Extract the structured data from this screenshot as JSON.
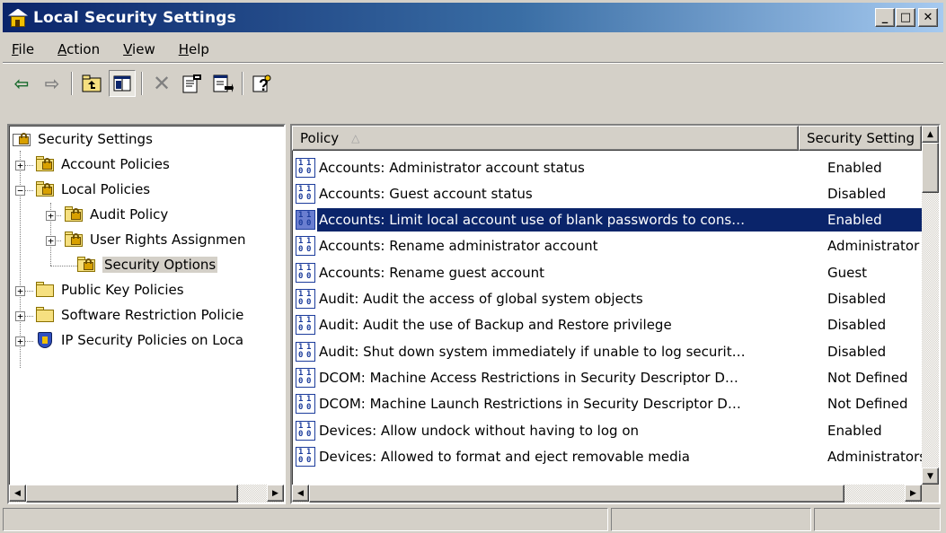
{
  "window": {
    "title": "Local Security Settings",
    "minimize_glyph": "_",
    "maximize_glyph": "□",
    "close_glyph": "✕"
  },
  "menu": [
    {
      "label": "File",
      "access_key": "F",
      "rest": "ile"
    },
    {
      "label": "Action",
      "access_key": "A",
      "rest": "ction"
    },
    {
      "label": "View",
      "access_key": "V",
      "rest": "iew"
    },
    {
      "label": "Help",
      "access_key": "H",
      "rest": "elp"
    }
  ],
  "toolbar": {
    "buttons": [
      "back-icon",
      "forward-icon",
      "up-one-level-icon",
      "show-hide-tree-icon",
      "delete-icon",
      "properties-icon",
      "export-list-icon",
      "help-icon"
    ],
    "glyphs": {
      "back": "⇦",
      "forward": "⇨",
      "up": "⮤",
      "tree": "▣",
      "delete": "✕",
      "properties": "🗎",
      "export": "⇲",
      "help": "?"
    }
  },
  "tree": {
    "root": "Security Settings",
    "items": [
      {
        "label": "Account Policies",
        "expander": "+"
      },
      {
        "label": "Local Policies",
        "expander": "−"
      },
      {
        "label": "Audit Policy",
        "expander": "+"
      },
      {
        "label": "User Rights Assignmen",
        "expander": "+"
      },
      {
        "label": "Security Options",
        "expander": ""
      },
      {
        "label": "Public Key Policies",
        "expander": "+"
      },
      {
        "label": "Software Restriction Policie",
        "expander": "+"
      },
      {
        "label": "IP Security Policies on Loca",
        "expander": "+"
      }
    ]
  },
  "list": {
    "columns": {
      "policy": "Policy",
      "setting": "Security Setting"
    },
    "sort_indicator": "△",
    "rows": [
      {
        "policy": "Accounts: Administrator account status",
        "setting": "Enabled"
      },
      {
        "policy": "Accounts: Guest account status",
        "setting": "Disabled"
      },
      {
        "policy": "Accounts: Limit local account use of blank passwords to cons…",
        "setting": "Enabled"
      },
      {
        "policy": "Accounts: Rename administrator account",
        "setting": "Administrator"
      },
      {
        "policy": "Accounts: Rename guest account",
        "setting": "Guest"
      },
      {
        "policy": "Audit: Audit the access of global system objects",
        "setting": "Disabled"
      },
      {
        "policy": "Audit: Audit the use of Backup and Restore privilege",
        "setting": "Disabled"
      },
      {
        "policy": "Audit: Shut down system immediately if unable to log securit…",
        "setting": "Disabled"
      },
      {
        "policy": "DCOM: Machine Access Restrictions in Security Descriptor D…",
        "setting": "Not Defined"
      },
      {
        "policy": "DCOM: Machine Launch Restrictions in Security Descriptor D…",
        "setting": "Not Defined"
      },
      {
        "policy": "Devices: Allow undock without having to log on",
        "setting": "Enabled"
      },
      {
        "policy": "Devices: Allowed to format and eject removable media",
        "setting": "Administrators"
      }
    ],
    "selected_index": 2
  },
  "colors": {
    "selection": "#0a246a",
    "titlebar_start": "#0a246a",
    "titlebar_end": "#a6caf0",
    "face": "#d4d0c8"
  }
}
